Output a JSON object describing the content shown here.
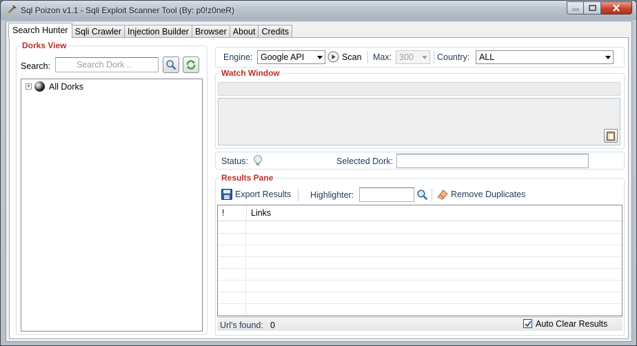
{
  "window": {
    "title": "Sql Poizon v1.1 - Sqli Exploit Scanner Tool (By: p0!z0neR)"
  },
  "tabs": [
    {
      "label": "Search Hunter"
    },
    {
      "label": "Sqli Crawler"
    },
    {
      "label": "Injection Builder"
    },
    {
      "label": "Browser"
    },
    {
      "label": "About"
    },
    {
      "label": "Credits"
    }
  ],
  "dorks_view": {
    "title": "Dorks View",
    "search_label": "Search:",
    "search_placeholder": "Search Dork ..",
    "tree_root": "All Dorks"
  },
  "engine_bar": {
    "engine_label": "Engine:",
    "engine_value": "Google API",
    "scan_label": "Scan",
    "max_label": "Max:",
    "max_value": "300",
    "country_label": "Country:",
    "country_value": "ALL"
  },
  "watch_window": {
    "title": "Watch Window"
  },
  "status_row": {
    "status_label": "Status:",
    "selected_dork_label": "Selected Dork:",
    "selected_dork_value": ""
  },
  "results": {
    "title": "Results Pane",
    "export_label": "Export Results",
    "highlighter_label": "Highlighter:",
    "highlighter_value": "",
    "remove_duplicates_label": "Remove Duplicates",
    "columns": [
      "!",
      "Links"
    ],
    "urls_found_label": "Url's found:",
    "urls_found_value": "0",
    "auto_clear_label": "Auto Clear Results",
    "auto_clear_checked": true
  },
  "colors": {
    "group_title": "#b83026",
    "label_text": "#1e395b"
  }
}
